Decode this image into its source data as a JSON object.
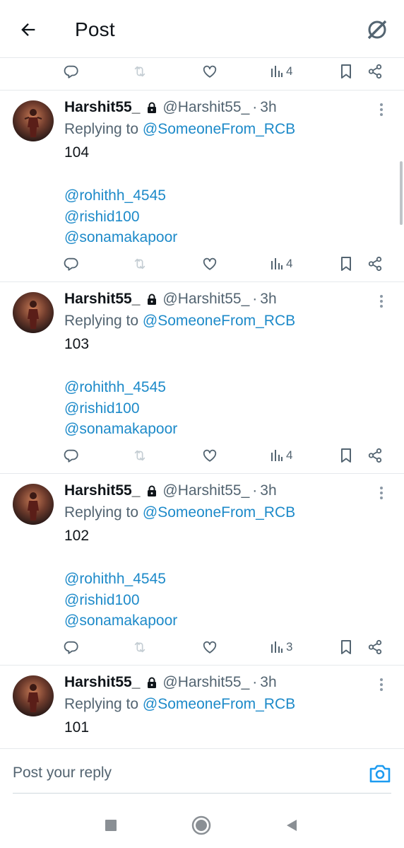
{
  "header": {
    "title": "Post"
  },
  "top_actions": {
    "views": "4"
  },
  "posts": [
    {
      "name": "Harshit55_",
      "handle": "@Harshit55_",
      "separator": "·",
      "time": "3h",
      "replying_prefix": "Replying to ",
      "replying_to": "@SomeoneFrom_RCB",
      "text": "104",
      "mentions": [
        "@rohithh_4545",
        "@rishid100",
        "@sonamakapoor"
      ],
      "views": "4"
    },
    {
      "name": "Harshit55_",
      "handle": "@Harshit55_",
      "separator": "·",
      "time": "3h",
      "replying_prefix": "Replying to ",
      "replying_to": "@SomeoneFrom_RCB",
      "text": "103",
      "mentions": [
        "@rohithh_4545",
        "@rishid100",
        "@sonamakapoor"
      ],
      "views": "4"
    },
    {
      "name": "Harshit55_",
      "handle": "@Harshit55_",
      "separator": "·",
      "time": "3h",
      "replying_prefix": "Replying to ",
      "replying_to": "@SomeoneFrom_RCB",
      "text": "102",
      "mentions": [
        "@rohithh_4545",
        "@rishid100",
        "@sonamakapoor"
      ],
      "views": "3"
    },
    {
      "name": "Harshit55_",
      "handle": "@Harshit55_",
      "separator": "·",
      "time": "3h",
      "replying_prefix": "Replying to ",
      "replying_to": "@SomeoneFrom_RCB",
      "text": "101"
    }
  ],
  "reply": {
    "placeholder": "Post your reply"
  },
  "icons": {
    "back": "arrow-left-icon",
    "grok": "grok-icon",
    "reply": "comment-icon",
    "repost": "repost-icon",
    "like": "heart-icon",
    "views": "bar-chart-icon",
    "bookmark": "bookmark-icon",
    "share": "share-icon",
    "lock": "lock-icon",
    "more": "more-vertical-icon",
    "camera": "camera-icon",
    "nav_recents": "square-icon",
    "nav_home": "circle-icon",
    "nav_back": "triangle-back-icon"
  },
  "colors": {
    "link": "#1d8ac9",
    "text": "#0f1419",
    "secondary": "#536471",
    "accent": "#1d9bf0"
  }
}
